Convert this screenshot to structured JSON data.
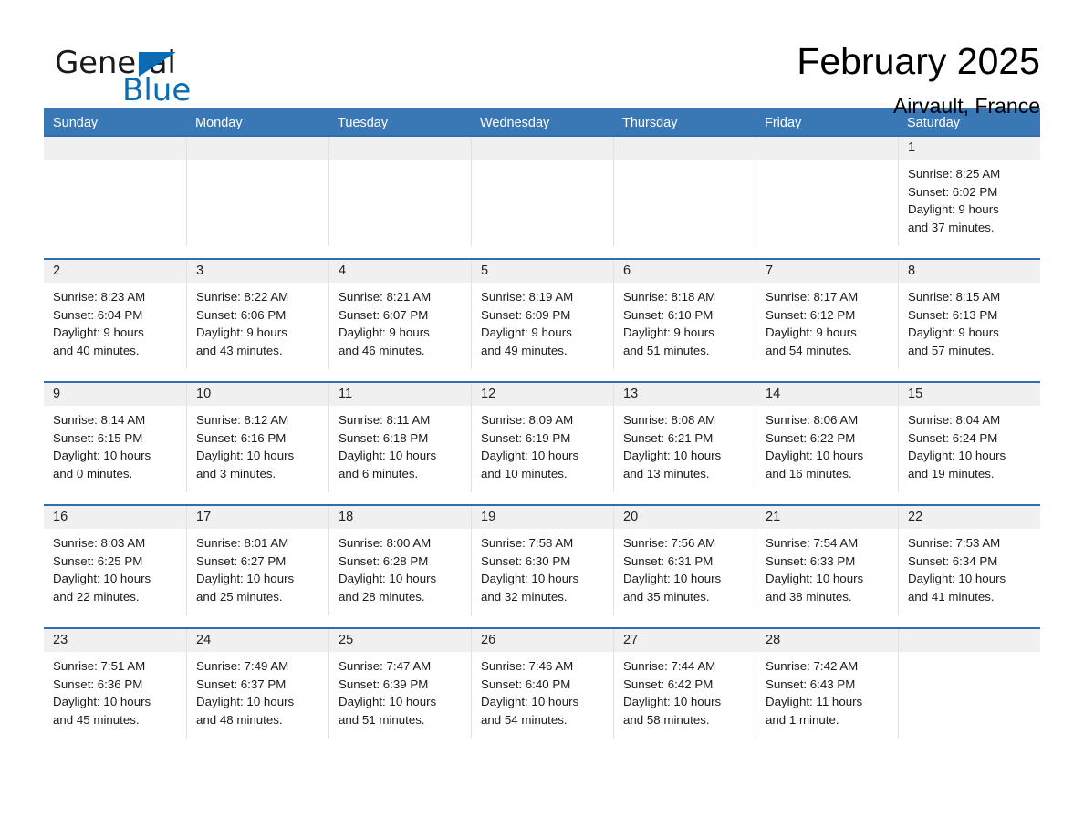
{
  "brand": {
    "name_part1": "General",
    "name_part2": "Blue",
    "triangle_icon": "triangle-logo-icon",
    "accent_color": "#0b6cb5"
  },
  "header": {
    "title": "February 2025",
    "subtitle": "Airvault, France"
  },
  "theme": {
    "header_blue": "#3a78b5",
    "row_rule_blue": "#2f6fad",
    "daynum_band": "#f0f0f0",
    "text": "#1a1a1a"
  },
  "weekdays": [
    "Sunday",
    "Monday",
    "Tuesday",
    "Wednesday",
    "Thursday",
    "Friday",
    "Saturday"
  ],
  "weeks": [
    [
      {
        "day": "",
        "empty": true
      },
      {
        "day": "",
        "empty": true
      },
      {
        "day": "",
        "empty": true
      },
      {
        "day": "",
        "empty": true
      },
      {
        "day": "",
        "empty": true
      },
      {
        "day": "",
        "empty": true
      },
      {
        "day": "1",
        "sunrise": "Sunrise: 8:25 AM",
        "sunset": "Sunset: 6:02 PM",
        "daylight1": "Daylight: 9 hours",
        "daylight2": "and 37 minutes."
      }
    ],
    [
      {
        "day": "2",
        "sunrise": "Sunrise: 8:23 AM",
        "sunset": "Sunset: 6:04 PM",
        "daylight1": "Daylight: 9 hours",
        "daylight2": "and 40 minutes."
      },
      {
        "day": "3",
        "sunrise": "Sunrise: 8:22 AM",
        "sunset": "Sunset: 6:06 PM",
        "daylight1": "Daylight: 9 hours",
        "daylight2": "and 43 minutes."
      },
      {
        "day": "4",
        "sunrise": "Sunrise: 8:21 AM",
        "sunset": "Sunset: 6:07 PM",
        "daylight1": "Daylight: 9 hours",
        "daylight2": "and 46 minutes."
      },
      {
        "day": "5",
        "sunrise": "Sunrise: 8:19 AM",
        "sunset": "Sunset: 6:09 PM",
        "daylight1": "Daylight: 9 hours",
        "daylight2": "and 49 minutes."
      },
      {
        "day": "6",
        "sunrise": "Sunrise: 8:18 AM",
        "sunset": "Sunset: 6:10 PM",
        "daylight1": "Daylight: 9 hours",
        "daylight2": "and 51 minutes."
      },
      {
        "day": "7",
        "sunrise": "Sunrise: 8:17 AM",
        "sunset": "Sunset: 6:12 PM",
        "daylight1": "Daylight: 9 hours",
        "daylight2": "and 54 minutes."
      },
      {
        "day": "8",
        "sunrise": "Sunrise: 8:15 AM",
        "sunset": "Sunset: 6:13 PM",
        "daylight1": "Daylight: 9 hours",
        "daylight2": "and 57 minutes."
      }
    ],
    [
      {
        "day": "9",
        "sunrise": "Sunrise: 8:14 AM",
        "sunset": "Sunset: 6:15 PM",
        "daylight1": "Daylight: 10 hours",
        "daylight2": "and 0 minutes."
      },
      {
        "day": "10",
        "sunrise": "Sunrise: 8:12 AM",
        "sunset": "Sunset: 6:16 PM",
        "daylight1": "Daylight: 10 hours",
        "daylight2": "and 3 minutes."
      },
      {
        "day": "11",
        "sunrise": "Sunrise: 8:11 AM",
        "sunset": "Sunset: 6:18 PM",
        "daylight1": "Daylight: 10 hours",
        "daylight2": "and 6 minutes."
      },
      {
        "day": "12",
        "sunrise": "Sunrise: 8:09 AM",
        "sunset": "Sunset: 6:19 PM",
        "daylight1": "Daylight: 10 hours",
        "daylight2": "and 10 minutes."
      },
      {
        "day": "13",
        "sunrise": "Sunrise: 8:08 AM",
        "sunset": "Sunset: 6:21 PM",
        "daylight1": "Daylight: 10 hours",
        "daylight2": "and 13 minutes."
      },
      {
        "day": "14",
        "sunrise": "Sunrise: 8:06 AM",
        "sunset": "Sunset: 6:22 PM",
        "daylight1": "Daylight: 10 hours",
        "daylight2": "and 16 minutes."
      },
      {
        "day": "15",
        "sunrise": "Sunrise: 8:04 AM",
        "sunset": "Sunset: 6:24 PM",
        "daylight1": "Daylight: 10 hours",
        "daylight2": "and 19 minutes."
      }
    ],
    [
      {
        "day": "16",
        "sunrise": "Sunrise: 8:03 AM",
        "sunset": "Sunset: 6:25 PM",
        "daylight1": "Daylight: 10 hours",
        "daylight2": "and 22 minutes."
      },
      {
        "day": "17",
        "sunrise": "Sunrise: 8:01 AM",
        "sunset": "Sunset: 6:27 PM",
        "daylight1": "Daylight: 10 hours",
        "daylight2": "and 25 minutes."
      },
      {
        "day": "18",
        "sunrise": "Sunrise: 8:00 AM",
        "sunset": "Sunset: 6:28 PM",
        "daylight1": "Daylight: 10 hours",
        "daylight2": "and 28 minutes."
      },
      {
        "day": "19",
        "sunrise": "Sunrise: 7:58 AM",
        "sunset": "Sunset: 6:30 PM",
        "daylight1": "Daylight: 10 hours",
        "daylight2": "and 32 minutes."
      },
      {
        "day": "20",
        "sunrise": "Sunrise: 7:56 AM",
        "sunset": "Sunset: 6:31 PM",
        "daylight1": "Daylight: 10 hours",
        "daylight2": "and 35 minutes."
      },
      {
        "day": "21",
        "sunrise": "Sunrise: 7:54 AM",
        "sunset": "Sunset: 6:33 PM",
        "daylight1": "Daylight: 10 hours",
        "daylight2": "and 38 minutes."
      },
      {
        "day": "22",
        "sunrise": "Sunrise: 7:53 AM",
        "sunset": "Sunset: 6:34 PM",
        "daylight1": "Daylight: 10 hours",
        "daylight2": "and 41 minutes."
      }
    ],
    [
      {
        "day": "23",
        "sunrise": "Sunrise: 7:51 AM",
        "sunset": "Sunset: 6:36 PM",
        "daylight1": "Daylight: 10 hours",
        "daylight2": "and 45 minutes."
      },
      {
        "day": "24",
        "sunrise": "Sunrise: 7:49 AM",
        "sunset": "Sunset: 6:37 PM",
        "daylight1": "Daylight: 10 hours",
        "daylight2": "and 48 minutes."
      },
      {
        "day": "25",
        "sunrise": "Sunrise: 7:47 AM",
        "sunset": "Sunset: 6:39 PM",
        "daylight1": "Daylight: 10 hours",
        "daylight2": "and 51 minutes."
      },
      {
        "day": "26",
        "sunrise": "Sunrise: 7:46 AM",
        "sunset": "Sunset: 6:40 PM",
        "daylight1": "Daylight: 10 hours",
        "daylight2": "and 54 minutes."
      },
      {
        "day": "27",
        "sunrise": "Sunrise: 7:44 AM",
        "sunset": "Sunset: 6:42 PM",
        "daylight1": "Daylight: 10 hours",
        "daylight2": "and 58 minutes."
      },
      {
        "day": "28",
        "sunrise": "Sunrise: 7:42 AM",
        "sunset": "Sunset: 6:43 PM",
        "daylight1": "Daylight: 11 hours",
        "daylight2": "and 1 minute."
      },
      {
        "day": "",
        "empty": true
      }
    ]
  ]
}
